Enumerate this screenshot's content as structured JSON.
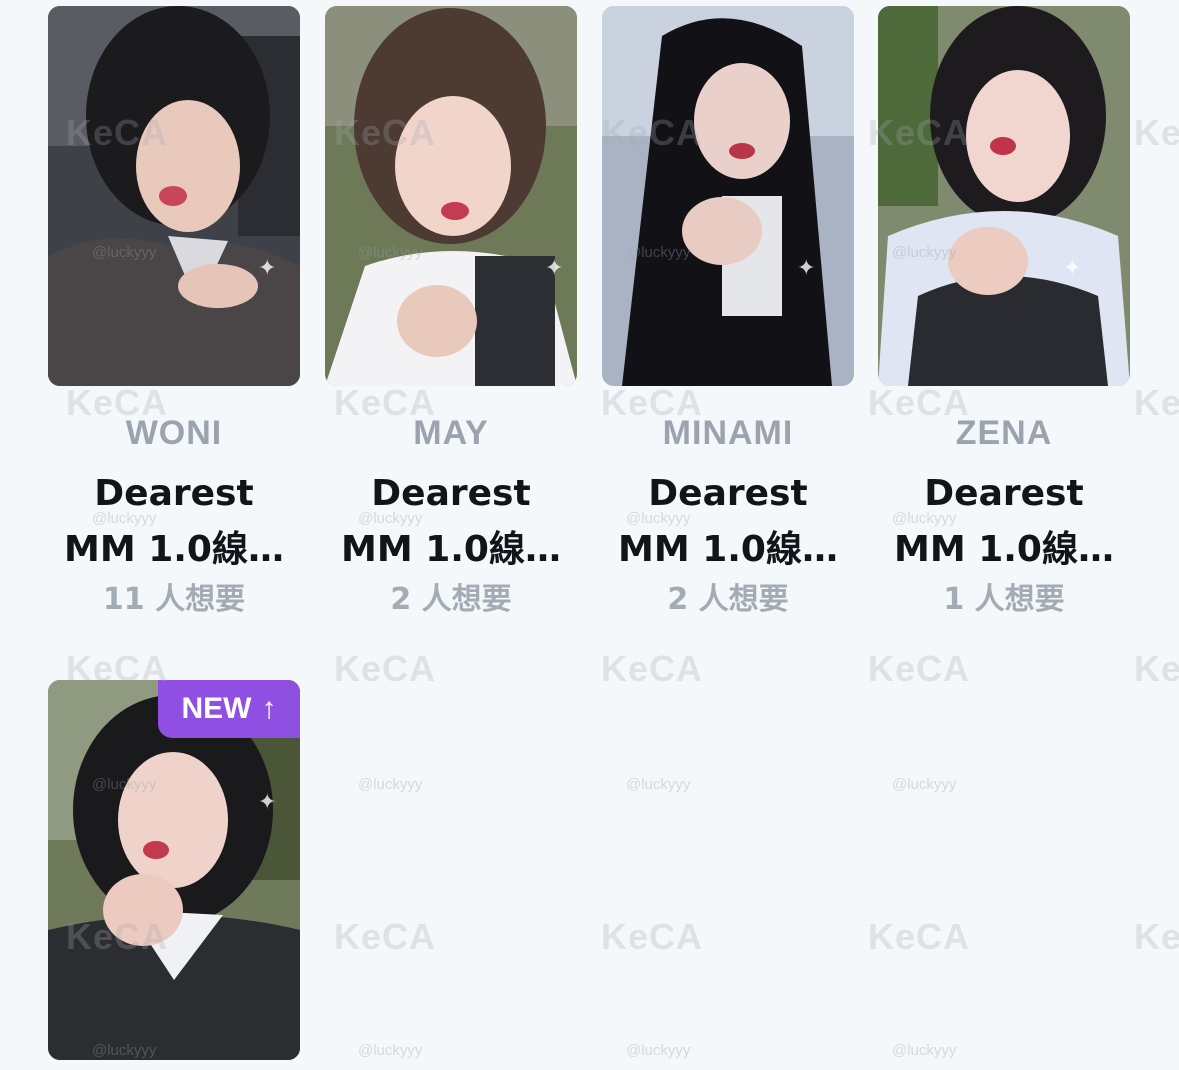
{
  "cards": [
    {
      "member": "WONI",
      "title_line1": "Dearest",
      "title_line2": "MM 1.0線…",
      "wants": "11 人想要"
    },
    {
      "member": "MAY",
      "title_line1": "Dearest",
      "title_line2": "MM 1.0線…",
      "wants": "2 人想要"
    },
    {
      "member": "MINAMI",
      "title_line1": "Dearest",
      "title_line2": "MM 1.0線…",
      "wants": "2 人想要"
    },
    {
      "member": "ZENA",
      "title_line1": "Dearest",
      "title_line2": "MM 1.0線…",
      "wants": "1 人想要"
    },
    {
      "badge": "NEW",
      "badge_icon": "arrow-up-icon"
    }
  ],
  "watermark": {
    "brand": "KeCA",
    "handle": "@luckyyy"
  },
  "colors": {
    "badge": "#8f4fe3",
    "member_text": "#9aa3ae",
    "title_text": "#111418",
    "wants_text": "#a3abb5"
  }
}
